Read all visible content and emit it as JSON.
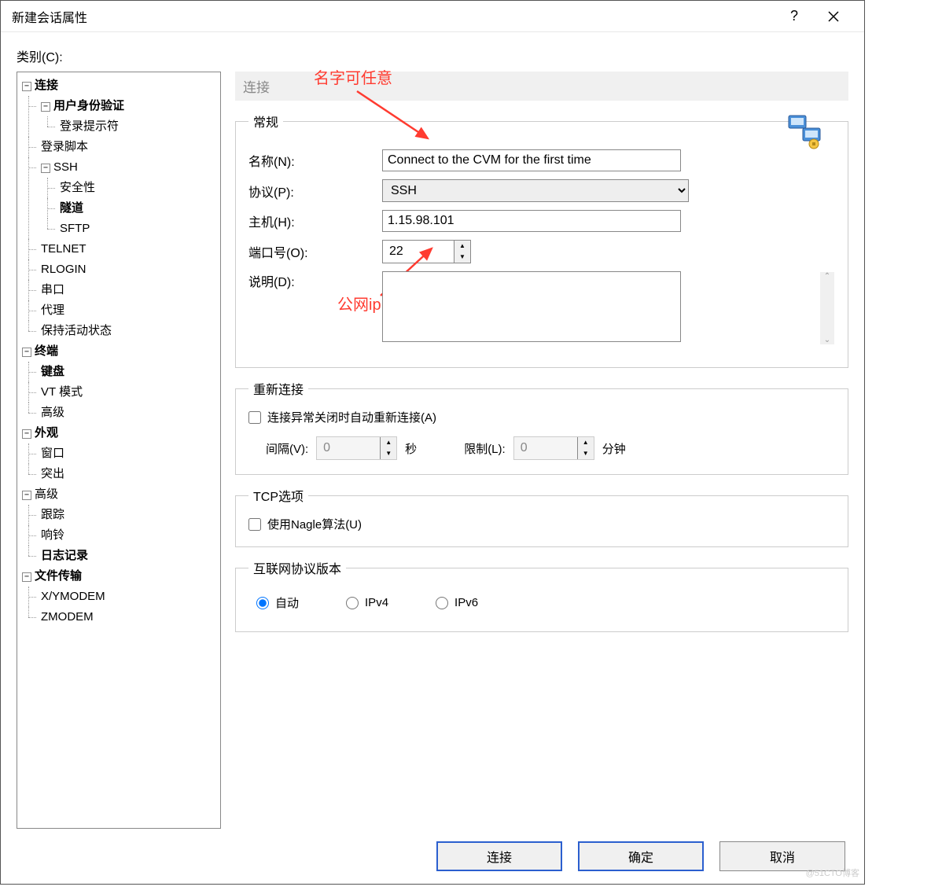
{
  "window": {
    "title": "新建会话属性",
    "help_symbol": "?",
    "close_symbol": "✕"
  },
  "category_label": "类别(C):",
  "tree": {
    "connection": "连接",
    "auth": "用户身份验证",
    "login_prompt": "登录提示符",
    "login_script": "登录脚本",
    "ssh": "SSH",
    "security": "安全性",
    "tunnel": "隧道",
    "sftp": "SFTP",
    "telnet": "TELNET",
    "rlogin": "RLOGIN",
    "serial": "串口",
    "proxy": "代理",
    "keepalive": "保持活动状态",
    "terminal": "终端",
    "keyboard": "键盘",
    "vtmode": "VT 模式",
    "advanced_term": "高级",
    "appearance": "外观",
    "window": "窗口",
    "highlight": "突出",
    "advanced": "高级",
    "trace": "跟踪",
    "bell": "响铃",
    "logging": "日志记录",
    "filetransfer": "文件传输",
    "xymodem": "X/YMODEM",
    "zmodem": "ZMODEM"
  },
  "panel": {
    "header": "连接",
    "general_legend": "常规",
    "name_label": "名称(N):",
    "name_value": "Connect to the CVM for the first time",
    "protocol_label": "协议(P):",
    "protocol_value": "SSH",
    "host_label": "主机(H):",
    "host_value": "1.15.98.101",
    "port_label": "端口号(O):",
    "port_value": "22",
    "desc_label": "说明(D):",
    "desc_value": "",
    "reconnect_legend": "重新连接",
    "reconnect_checkbox": "连接异常关闭时自动重新连接(A)",
    "interval_label": "间隔(V):",
    "interval_value": "0",
    "seconds_label": "秒",
    "limit_label": "限制(L):",
    "limit_value": "0",
    "minutes_label": "分钟",
    "tcp_legend": "TCP选项",
    "nagle_checkbox": "使用Nagle算法(U)",
    "ipver_legend": "互联网协议版本",
    "ip_auto": "自动",
    "ip_v4": "IPv4",
    "ip_v6": "IPv6"
  },
  "buttons": {
    "connect": "连接",
    "ok": "确定",
    "cancel": "取消"
  },
  "annotations": {
    "name_hint": "名字可任意",
    "ip_hint": "公网ip"
  },
  "watermark": "@51CTO博客"
}
